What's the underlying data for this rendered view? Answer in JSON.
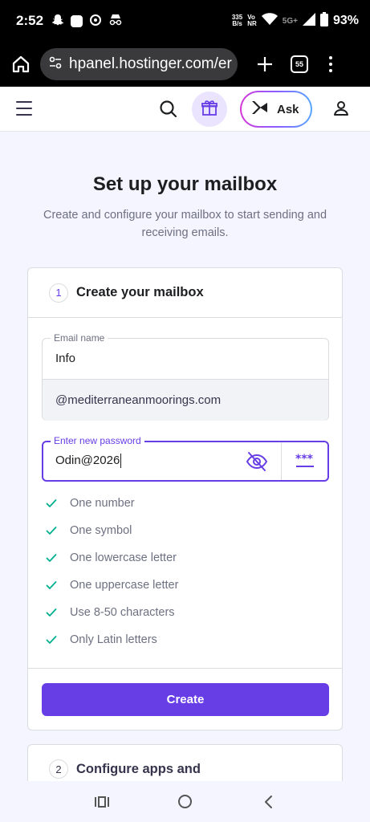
{
  "status_bar": {
    "time": "2:52",
    "net_speed_value": "335",
    "net_speed_unit": "B/s",
    "volte_line1": "Vo",
    "volte_line2": "NR",
    "network": "5G+",
    "battery": "93%"
  },
  "browser": {
    "url": "hpanel.hostinger.com/er",
    "tab_count": "55"
  },
  "header": {
    "ask_label": "Ask"
  },
  "page": {
    "title": "Set up your mailbox",
    "subtitle": "Create and configure your mailbox to start sending and receiving emails."
  },
  "step1": {
    "number": "1",
    "title": "Create your mailbox",
    "email_label": "Email name",
    "email_value": "Info",
    "domain": "@mediterraneanmoorings.com",
    "password_label": "Enter new password",
    "password_value": "Odin@2026",
    "rules": [
      "One number",
      "One symbol",
      "One lowercase letter",
      "One uppercase letter",
      "Use 8-50 characters",
      "Only Latin letters"
    ],
    "create_label": "Create"
  },
  "step2": {
    "number": "2",
    "title": "Configure apps and"
  },
  "colors": {
    "accent": "#673de6",
    "check": "#00b090"
  }
}
